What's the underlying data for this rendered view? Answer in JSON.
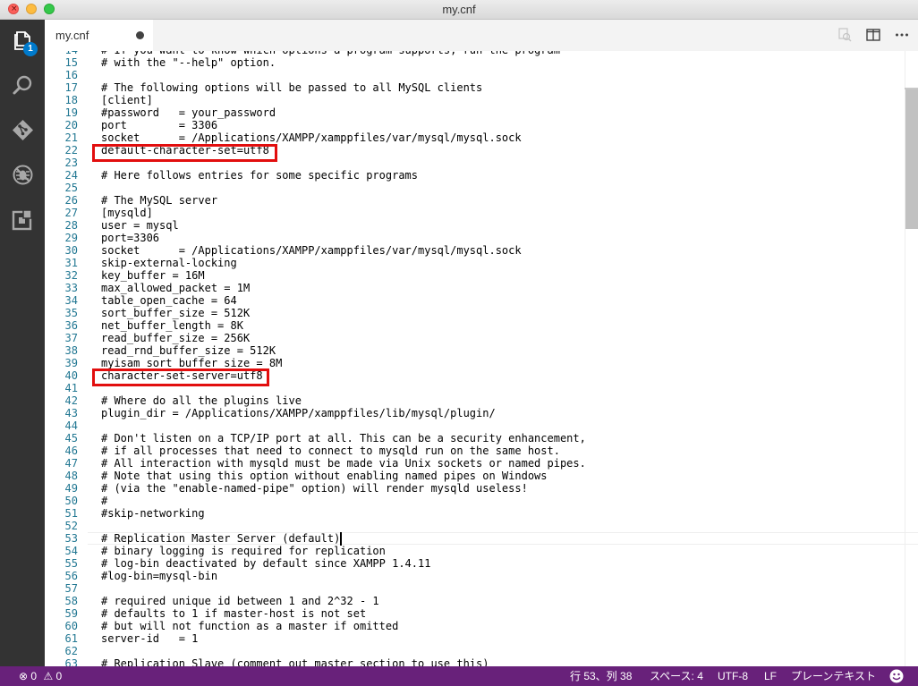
{
  "window": {
    "title": "my.cnf"
  },
  "activity_bar": {
    "icons": [
      "explorer-icon",
      "search-icon",
      "git-icon",
      "debug-icon",
      "extensions-icon"
    ],
    "explorer_badge": "1"
  },
  "tab": {
    "label": "my.cnf"
  },
  "editor": {
    "lines": [
      {
        "n": "14",
        "text": "# If you want to know which options a program supports, run the program"
      },
      {
        "n": "15",
        "text": "# with the \"--help\" option."
      },
      {
        "n": "16",
        "text": ""
      },
      {
        "n": "17",
        "text": "# The following options will be passed to all MySQL clients"
      },
      {
        "n": "18",
        "text": "[client]"
      },
      {
        "n": "19",
        "text": "#password   = your_password"
      },
      {
        "n": "20",
        "text": "port        = 3306"
      },
      {
        "n": "21",
        "text": "socket      = /Applications/XAMPP/xamppfiles/var/mysql/mysql.sock"
      },
      {
        "n": "22",
        "text": "default-character-set=utf8"
      },
      {
        "n": "23",
        "text": ""
      },
      {
        "n": "24",
        "text": "# Here follows entries for some specific programs"
      },
      {
        "n": "25",
        "text": ""
      },
      {
        "n": "26",
        "text": "# The MySQL server"
      },
      {
        "n": "27",
        "text": "[mysqld]"
      },
      {
        "n": "28",
        "text": "user = mysql"
      },
      {
        "n": "29",
        "text": "port=3306"
      },
      {
        "n": "30",
        "text": "socket      = /Applications/XAMPP/xamppfiles/var/mysql/mysql.sock"
      },
      {
        "n": "31",
        "text": "skip-external-locking"
      },
      {
        "n": "32",
        "text": "key_buffer = 16M"
      },
      {
        "n": "33",
        "text": "max_allowed_packet = 1M"
      },
      {
        "n": "34",
        "text": "table_open_cache = 64"
      },
      {
        "n": "35",
        "text": "sort_buffer_size = 512K"
      },
      {
        "n": "36",
        "text": "net_buffer_length = 8K"
      },
      {
        "n": "37",
        "text": "read_buffer_size = 256K"
      },
      {
        "n": "38",
        "text": "read_rnd_buffer_size = 512K"
      },
      {
        "n": "39",
        "text": "myisam_sort_buffer_size = 8M"
      },
      {
        "n": "40",
        "text": "character-set-server=utf8"
      },
      {
        "n": "41",
        "text": ""
      },
      {
        "n": "42",
        "text": "# Where do all the plugins live"
      },
      {
        "n": "43",
        "text": "plugin_dir = /Applications/XAMPP/xamppfiles/lib/mysql/plugin/"
      },
      {
        "n": "44",
        "text": ""
      },
      {
        "n": "45",
        "text": "# Don't listen on a TCP/IP port at all. This can be a security enhancement,"
      },
      {
        "n": "46",
        "text": "# if all processes that need to connect to mysqld run on the same host."
      },
      {
        "n": "47",
        "text": "# All interaction with mysqld must be made via Unix sockets or named pipes."
      },
      {
        "n": "48",
        "text": "# Note that using this option without enabling named pipes on Windows"
      },
      {
        "n": "49",
        "text": "# (via the \"enable-named-pipe\" option) will render mysqld useless!"
      },
      {
        "n": "50",
        "text": "#"
      },
      {
        "n": "51",
        "text": "#skip-networking"
      },
      {
        "n": "52",
        "text": ""
      },
      {
        "n": "53",
        "text": "# Replication Master Server (default)"
      },
      {
        "n": "54",
        "text": "# binary logging is required for replication"
      },
      {
        "n": "55",
        "text": "# log-bin deactivated by default since XAMPP 1.4.11"
      },
      {
        "n": "56",
        "text": "#log-bin=mysql-bin"
      },
      {
        "n": "57",
        "text": ""
      },
      {
        "n": "58",
        "text": "# required unique id between 1 and 2^32 - 1"
      },
      {
        "n": "59",
        "text": "# defaults to 1 if master-host is not set"
      },
      {
        "n": "60",
        "text": "# but will not function as a master if omitted"
      },
      {
        "n": "61",
        "text": "server-id   = 1"
      },
      {
        "n": "62",
        "text": ""
      },
      {
        "n": "63",
        "text": "# Replication Slave (comment out master section to use this)"
      }
    ]
  },
  "status_bar": {
    "errors": "0",
    "warnings": "0",
    "position": "行 53、列 38",
    "indent": "スペース: 4",
    "encoding": "UTF-8",
    "eol": "LF",
    "language": "プレーンテキスト"
  },
  "colors": {
    "status_bar": "#68217a",
    "activity_bar": "#333333",
    "highlight_box": "#e20e0e",
    "line_number": "#237893",
    "badge": "#007acc"
  }
}
